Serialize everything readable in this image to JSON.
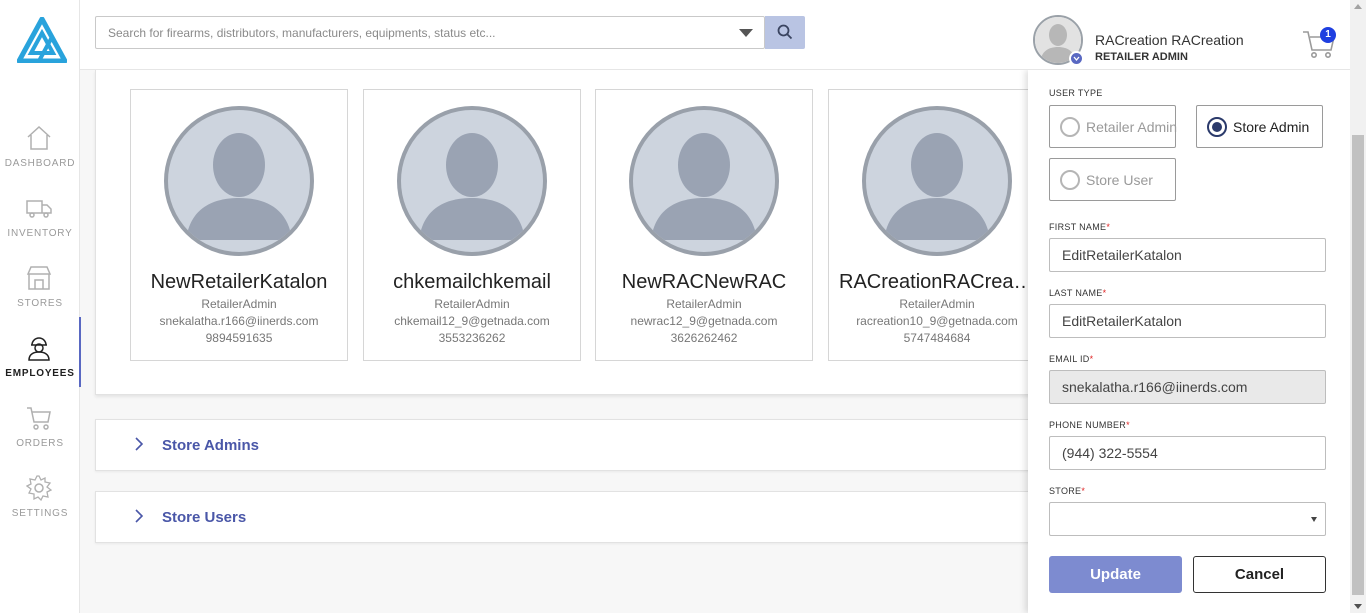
{
  "colors": {
    "accent": "#5968c2",
    "link": "#4a57a8",
    "update_button": "#7d8bd0",
    "cart_badge": "#1f3fe0",
    "required": "#e02424"
  },
  "sidebar": {
    "items": [
      {
        "label": "DASHBOARD",
        "icon": "home-icon",
        "active": false
      },
      {
        "label": "INVENTORY",
        "icon": "truck-icon",
        "active": false
      },
      {
        "label": "STORES",
        "icon": "store-icon",
        "active": false
      },
      {
        "label": "EMPLOYEES",
        "icon": "employee-icon",
        "active": true
      },
      {
        "label": "ORDERS",
        "icon": "cart-icon",
        "active": false
      },
      {
        "label": "SETTINGS",
        "icon": "gear-icon",
        "active": false
      }
    ]
  },
  "header": {
    "search_placeholder": "Search for firearms, distributors, manufacturers, equipments, status etc...",
    "user_name": "RACreation RACreation",
    "user_role": "RETAILER ADMIN",
    "cart_count": "1"
  },
  "employees": [
    {
      "name": "NewRetailerKatalon",
      "role": "RetailerAdmin",
      "email": "snekalatha.r166@iinerds.com",
      "phone": "9894591635"
    },
    {
      "name": "chkemailchkemail",
      "role": "RetailerAdmin",
      "email": "chkemail12_9@getnada.com",
      "phone": "3553236262"
    },
    {
      "name": "NewRACNewRAC",
      "role": "RetailerAdmin",
      "email": "newrac12_9@getnada.com",
      "phone": "3626262462"
    },
    {
      "name": "RACreationRACreation",
      "role": "RetailerAdmin",
      "email": "racreation10_9@getnada.com",
      "phone": "5747484684"
    }
  ],
  "sections": [
    {
      "label": "Store Admins"
    },
    {
      "label": "Store Users"
    }
  ],
  "panel": {
    "user_type_label": "USER TYPE",
    "user_types": [
      {
        "label": "Retailer Admin",
        "selected": false
      },
      {
        "label": "Store Admin",
        "selected": true
      },
      {
        "label": "Store User",
        "selected": false
      }
    ],
    "first_name_label": "FIRST NAME",
    "first_name_value": "EditRetailerKatalon",
    "last_name_label": "LAST NAME",
    "last_name_value": "EditRetailerKatalon",
    "email_label": "EMAIL ID",
    "email_value": "snekalatha.r166@iinerds.com",
    "phone_label": "PHONE NUMBER",
    "phone_value": "(944) 322-5554",
    "store_label": "STORE",
    "store_value": "",
    "required_mark": "*",
    "update_label": "Update",
    "cancel_label": "Cancel"
  }
}
